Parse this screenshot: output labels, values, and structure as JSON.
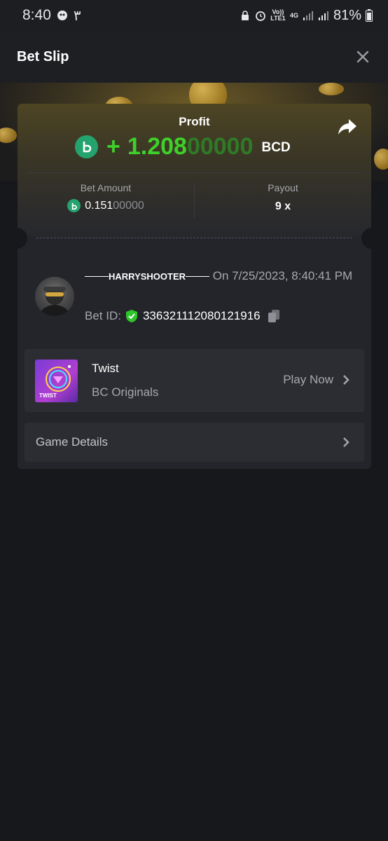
{
  "status_bar": {
    "time": "8:40",
    "extra": "٣",
    "network": "Vo)) LTE1",
    "net_type": "4G",
    "battery": "81%"
  },
  "header": {
    "title": "Bet Slip"
  },
  "profit": {
    "label": "Profit",
    "sign": "+",
    "amount_main": "1.208",
    "amount_dim": "00000",
    "currency": "BCD"
  },
  "bet_amount": {
    "label": "Bet Amount",
    "value_main": "0.151",
    "value_dim": "00000"
  },
  "payout": {
    "label": "Payout",
    "value": "9 x"
  },
  "user": {
    "username": "HARRYSHOOTER",
    "on_label": "On",
    "datetime": "7/25/2023, 8:40:41 PM",
    "bet_id_label": "Bet ID:",
    "bet_id": "336321112080121916"
  },
  "game": {
    "name": "Twist",
    "provider": "BC Originals",
    "thumb_text": "TWIST",
    "play_label": "Play Now"
  },
  "details": {
    "label": "Game Details"
  },
  "colors": {
    "profit_green": "#3ed12a",
    "coin_green": "#25a36f",
    "shield_green": "#2ec52a"
  }
}
